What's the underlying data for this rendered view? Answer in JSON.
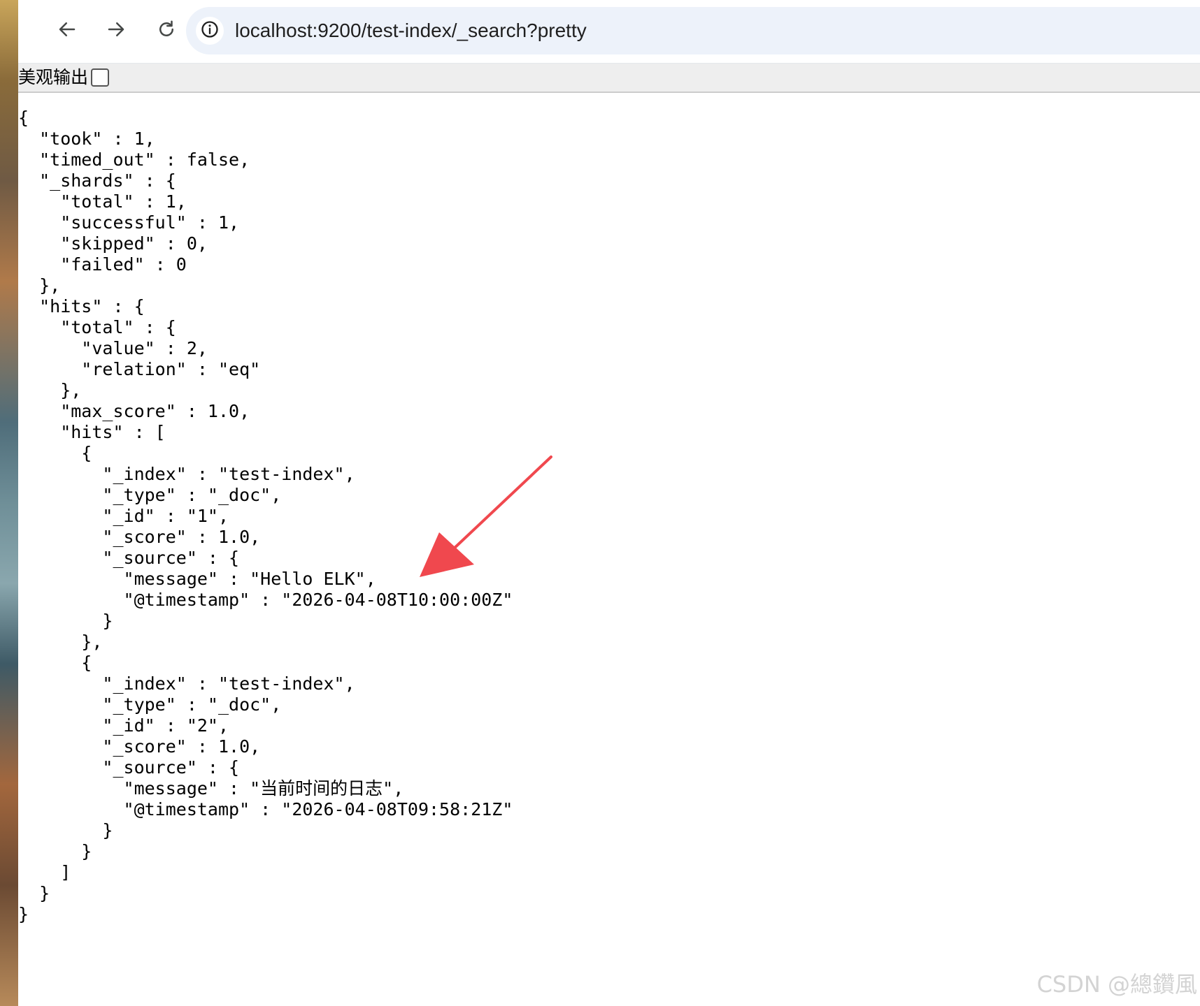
{
  "browser": {
    "url": "localhost:9200/test-index/_search?pretty",
    "back_icon": "arrow-left-icon",
    "forward_icon": "arrow-right-icon",
    "reload_icon": "reload-icon",
    "site_info_icon": "info-circle-icon"
  },
  "prettyprint": {
    "label": "美观输出",
    "checked": false
  },
  "json_lines": [
    "{",
    "  \"took\" : 1,",
    "  \"timed_out\" : false,",
    "  \"_shards\" : {",
    "    \"total\" : 1,",
    "    \"successful\" : 1,",
    "    \"skipped\" : 0,",
    "    \"failed\" : 0",
    "  },",
    "  \"hits\" : {",
    "    \"total\" : {",
    "      \"value\" : 2,",
    "      \"relation\" : \"eq\"",
    "    },",
    "    \"max_score\" : 1.0,",
    "    \"hits\" : [",
    "      {",
    "        \"_index\" : \"test-index\",",
    "        \"_type\" : \"_doc\",",
    "        \"_id\" : \"1\",",
    "        \"_score\" : 1.0,",
    "        \"_source\" : {",
    "          \"message\" : \"Hello ELK\",",
    "          \"@timestamp\" : \"2026-04-08T10:00:00Z\"",
    "        }",
    "      },",
    "      {",
    "        \"_index\" : \"test-index\",",
    "        \"_type\" : \"_doc\",",
    "        \"_id\" : \"2\",",
    "        \"_score\" : 1.0,",
    "        \"_source\" : {",
    "          \"message\" : \"当前时间的日志\",",
    "          \"@timestamp\" : \"2026-04-08T09:58:21Z\"",
    "        }",
    "      }",
    "    ]",
    "  }",
    "}"
  ],
  "annotation": {
    "arrow_icon": "red-arrow-icon",
    "color": "#f0484e"
  },
  "watermark": "CSDN @總鑽風"
}
